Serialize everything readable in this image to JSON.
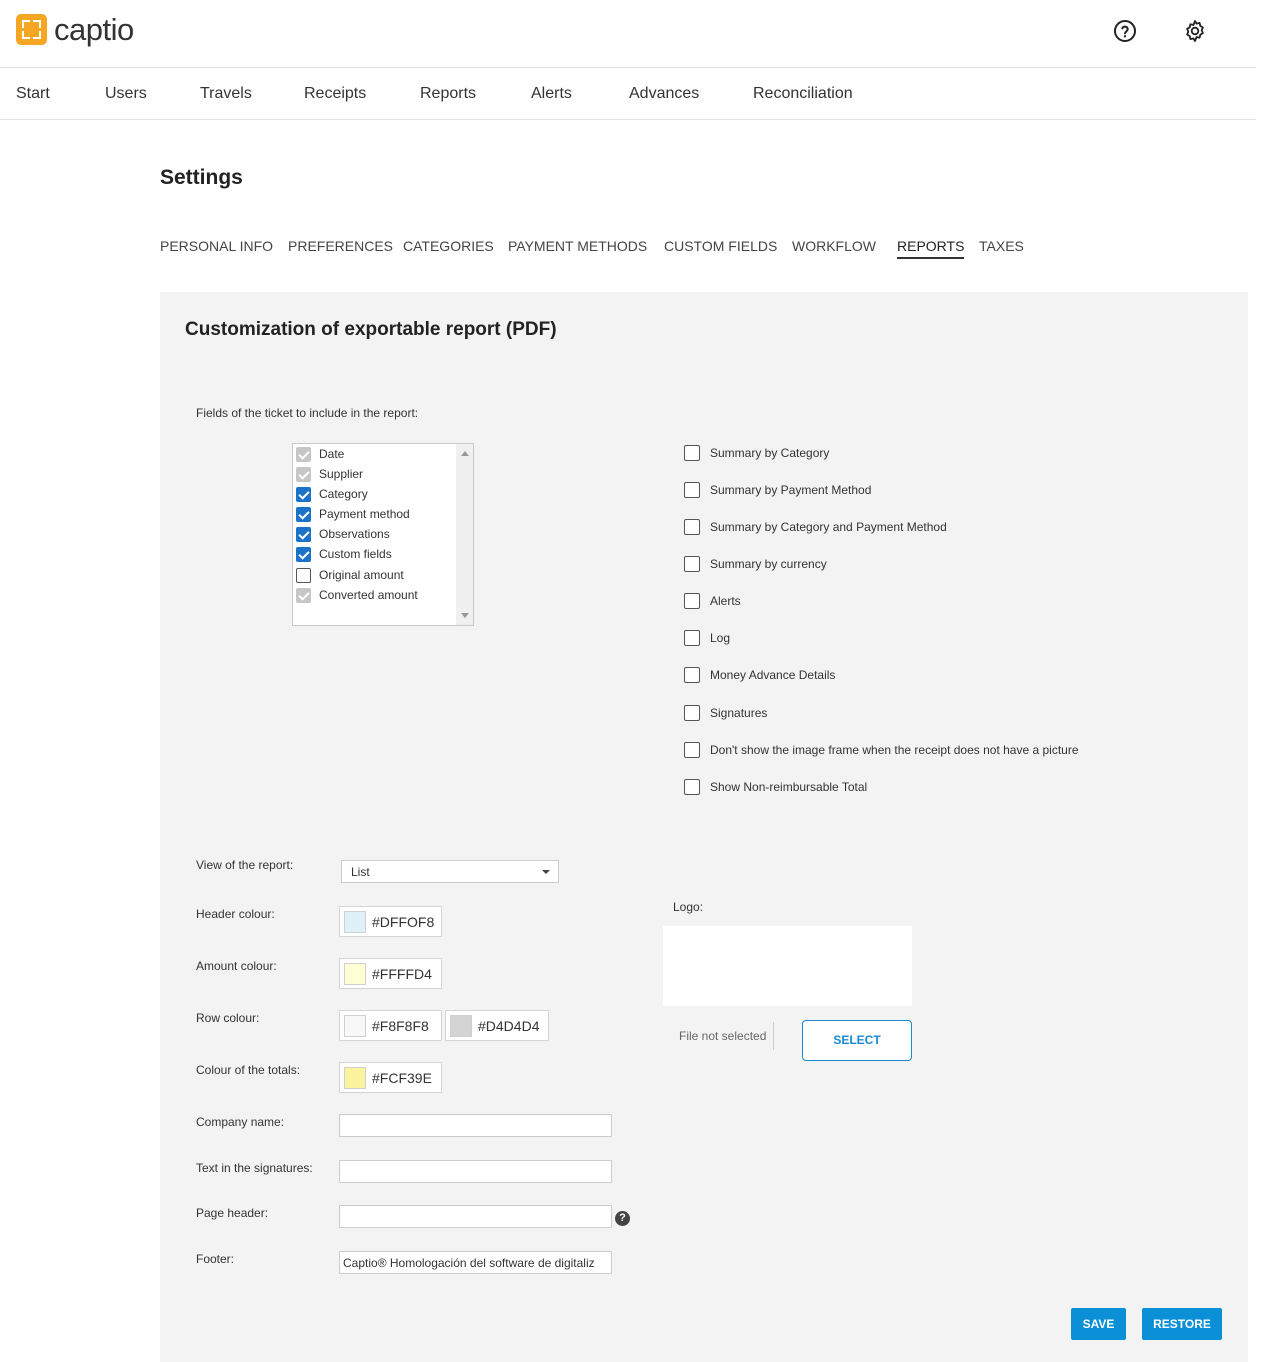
{
  "app": {
    "logo_text": "captio"
  },
  "header_icons": {
    "help": "help-circle-icon",
    "settings": "gear-icon"
  },
  "nav": [
    "Start",
    "Users",
    "Travels",
    "Receipts",
    "Reports",
    "Alerts",
    "Advances",
    "Reconciliation"
  ],
  "page_title": "Settings",
  "tabs": [
    "PERSONAL INFO",
    "PREFERENCES",
    "CATEGORIES",
    "PAYMENT METHODS",
    "CUSTOM FIELDS",
    "WORKFLOW",
    "REPORTS",
    "TAXES"
  ],
  "active_tab": "REPORTS",
  "panel": {
    "title": "Customization of exportable report (PDF)",
    "fields_label": "Fields of the ticket to include in the report:",
    "fields": [
      {
        "label": "Date",
        "state": "disabled-checked"
      },
      {
        "label": "Supplier",
        "state": "disabled-checked"
      },
      {
        "label": "Category",
        "state": "checked"
      },
      {
        "label": "Payment method",
        "state": "checked"
      },
      {
        "label": "Observations",
        "state": "checked"
      },
      {
        "label": "Custom fields",
        "state": "checked"
      },
      {
        "label": "Original amount",
        "state": "unchecked"
      },
      {
        "label": "Converted amount",
        "state": "disabled-checked"
      }
    ],
    "options": [
      {
        "label": "Summary by Category",
        "checked": false
      },
      {
        "label": "Summary by Payment Method",
        "checked": false
      },
      {
        "label": "Summary by Category and Payment Method",
        "checked": false
      },
      {
        "label": "Summary by currency",
        "checked": false
      },
      {
        "label": "Alerts",
        "checked": false
      },
      {
        "label": "Log",
        "checked": false
      },
      {
        "label": "Money Advance Details",
        "checked": false
      },
      {
        "label": "Signatures",
        "checked": false
      },
      {
        "label": "Don't show the image frame when the receipt does not have a picture",
        "checked": false
      },
      {
        "label": "Show Non-reimbursable Total",
        "checked": false
      }
    ],
    "view_label": "View of the report:",
    "view_value": "List",
    "header_colour_label": "Header colour:",
    "header_colour": "#DFF0F8",
    "header_colour_text": "#DFFOF8",
    "amount_colour_label": "Amount colour:",
    "amount_colour": "#FFFFD4",
    "amount_colour_text": "#FFFFD4",
    "row_colour_label": "Row colour:",
    "row_colour_1": "#F8F8F8",
    "row_colour_1_text": "#F8F8F8",
    "row_colour_2": "#D4D4D4",
    "row_colour_2_text": "#D4D4D4",
    "totals_colour_label": "Colour of the totals:",
    "totals_colour": "#FCF39E",
    "totals_colour_text": "#FCF39E",
    "company_name_label": "Company name:",
    "company_name": "",
    "signatures_label": "Text in the signatures:",
    "signatures_text": "",
    "page_header_label": "Page header:",
    "page_header": "",
    "page_header_help": "?",
    "footer_label": "Footer:",
    "footer": "Captio® Homologación del software de digitaliz",
    "logo_label": "Logo:",
    "file_status": "File not selected",
    "select_button": "SELECT"
  },
  "actions": {
    "save": "SAVE",
    "restore": "RESTORE"
  },
  "colors": {
    "accent": "#0B8FD6",
    "brand": "#F5A623",
    "checkbox": "#1A73C8"
  }
}
